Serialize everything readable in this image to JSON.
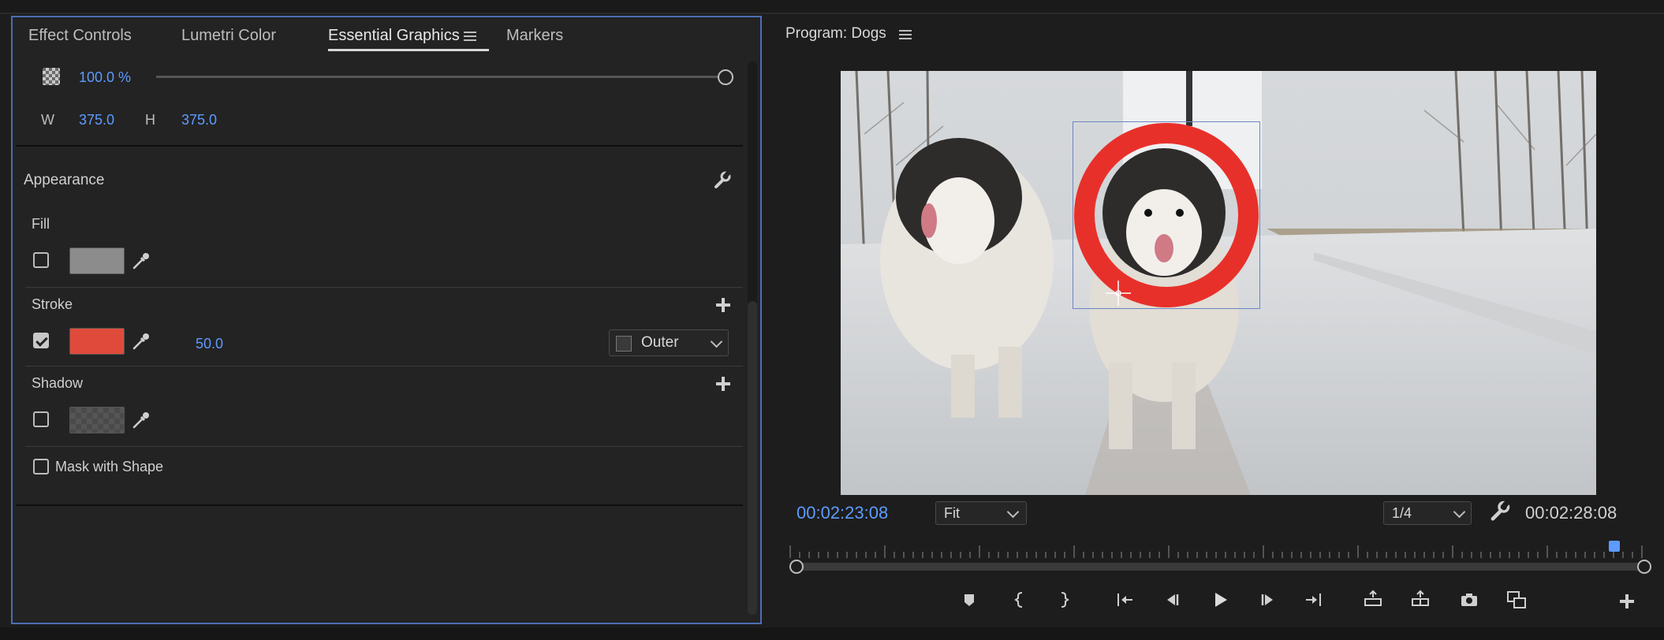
{
  "left_panel": {
    "tabs": [
      {
        "label": "Effect Controls"
      },
      {
        "label": "Lumetri Color"
      },
      {
        "label": "Essential Graphics"
      },
      {
        "label": "Markers"
      }
    ],
    "opacity": "100.0 %",
    "w_label": "W",
    "w_value": "375.0",
    "h_label": "H",
    "h_value": "375.0",
    "appearance_title": "Appearance",
    "fill": {
      "title": "Fill",
      "enabled": false,
      "color": "#8c8c8c"
    },
    "stroke": {
      "title": "Stroke",
      "enabled": true,
      "color": "#e04a3a",
      "width": "50.0",
      "type": "Outer"
    },
    "shadow": {
      "title": "Shadow",
      "enabled": false
    },
    "mask_label": "Mask with Shape"
  },
  "program": {
    "title": "Program: Dogs",
    "current_time": "00:02:23:08",
    "zoom": "Fit",
    "resolution": "1/4",
    "duration": "00:02:28:08",
    "accent": "#5d9bff",
    "circle_color": "#e8302a"
  }
}
